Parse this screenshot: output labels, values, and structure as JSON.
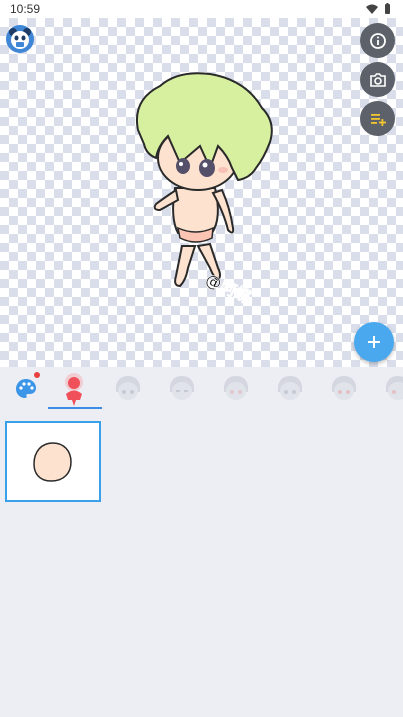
{
  "status_bar": {
    "time": "10:59"
  },
  "canvas": {
    "watermark": "@阿蝶"
  },
  "side_buttons": [
    {
      "icon": "info-icon"
    },
    {
      "icon": "camera-icon"
    },
    {
      "icon": "add-list-icon"
    }
  ],
  "fab": {
    "icon": "plus-icon"
  },
  "tabs": [
    {
      "icon": "palette-icon"
    },
    {
      "icon": "body-icon"
    },
    {
      "icon": "head-icon"
    },
    {
      "icon": "head-icon"
    },
    {
      "icon": "head-icon"
    },
    {
      "icon": "head-icon"
    },
    {
      "icon": "head-icon"
    },
    {
      "icon": "head-icon"
    }
  ],
  "colors": {
    "accent": "#3a8ee6",
    "fab": "#4aa8ef",
    "selected_tab": "#f0505a",
    "hair": "#d6f0a0",
    "skin": "#fde3cf"
  }
}
